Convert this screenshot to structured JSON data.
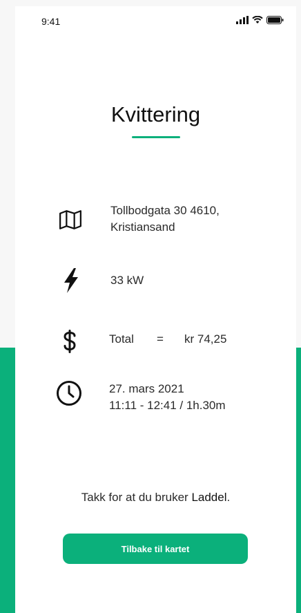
{
  "status": {
    "time": "9:41"
  },
  "receipt": {
    "title": "Kvittering",
    "address": {
      "line1": "Tollbodgata 30 4610,",
      "line2": "Kristiansand"
    },
    "power": "33 kW",
    "total": {
      "label": "Total",
      "equals": "=",
      "amount": "kr 74,25"
    },
    "time": {
      "date": "27. mars 2021",
      "range": "11:11 - 12:41 / 1h.30m"
    }
  },
  "footer": {
    "thanks_prefix": "Takk for at du bruker ",
    "brand": "Laddel",
    "thanks_suffix": ".",
    "button_label": "Tilbake til kartet"
  },
  "colors": {
    "accent": "#0bb07b"
  }
}
